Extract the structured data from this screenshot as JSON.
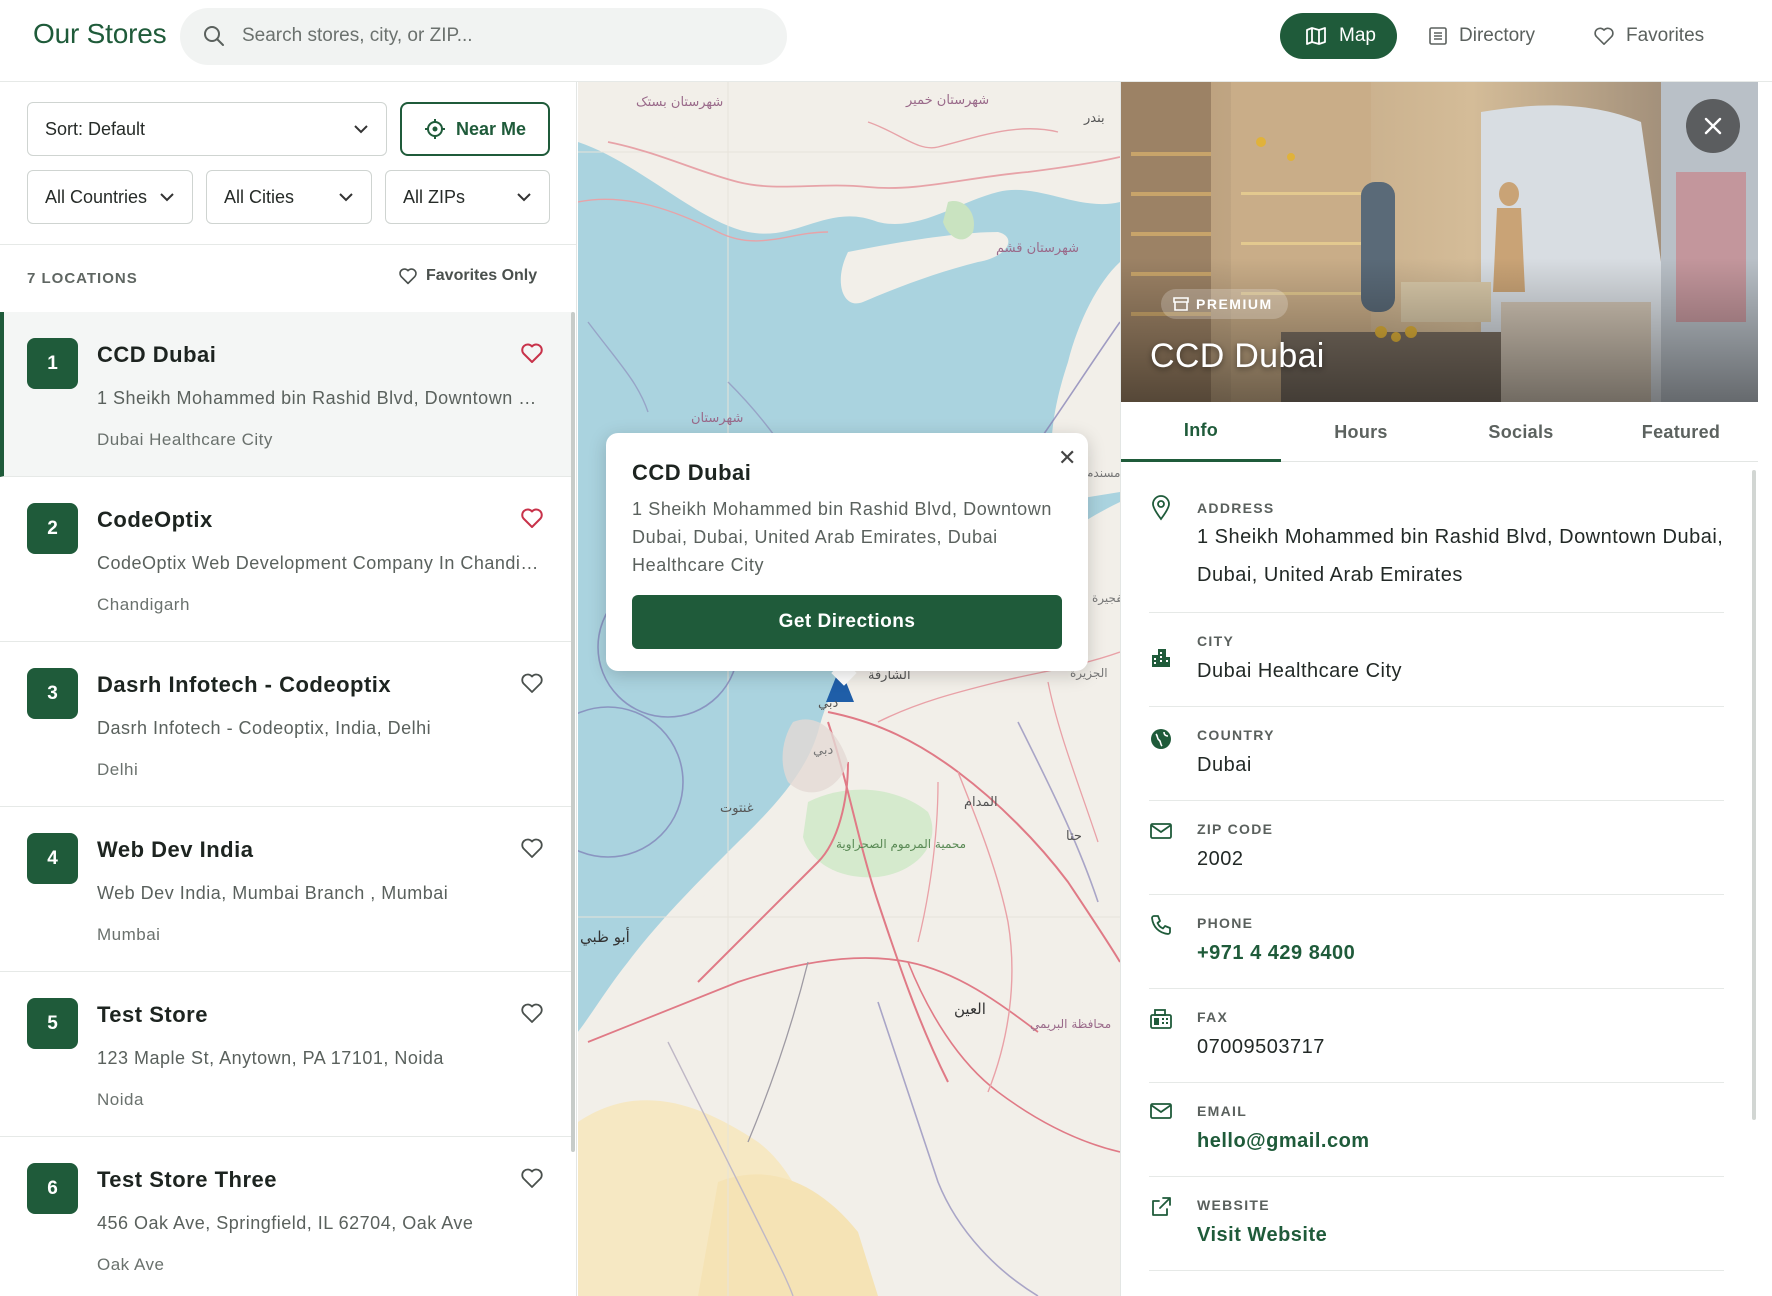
{
  "header": {
    "brand": "Our Stores",
    "search_placeholder": "Search stores, city, or ZIP...",
    "nav": {
      "map": "Map",
      "directory": "Directory",
      "favorites": "Favorites"
    }
  },
  "filters": {
    "sort": "Sort: Default",
    "near_me": "Near Me",
    "country": "All Countries",
    "city": "All Cities",
    "zip": "All ZIPs"
  },
  "list": {
    "count": "7 LOCATIONS",
    "favorites_only": "Favorites Only",
    "stores": [
      {
        "num": "1",
        "name": "CCD Dubai",
        "address": "1 Sheikh Mohammed bin Rashid Blvd, Downtown Dubai, Dubai, United Arab Emirates, Dubai Healthcare City",
        "city": "Dubai Healthcare City",
        "favorite": true
      },
      {
        "num": "2",
        "name": "CodeOptix",
        "address": "CodeOptix Web Development Company In Chandigarh",
        "city": "Chandigarh",
        "favorite": true
      },
      {
        "num": "3",
        "name": "Dasrh Infotech - Codeoptix",
        "address": "Dasrh Infotech - Codeoptix, India, Delhi",
        "city": "Delhi",
        "favorite": false
      },
      {
        "num": "4",
        "name": "Web Dev India",
        "address": "Web Dev India, Mumbai Branch , Mumbai",
        "city": "Mumbai",
        "favorite": false
      },
      {
        "num": "5",
        "name": "Test Store",
        "address": "123 Maple St, Anytown, PA 17101, Noida",
        "city": "Noida",
        "favorite": false
      },
      {
        "num": "6",
        "name": "Test Store Three",
        "address": "456 Oak Ave, Springfield, IL 62704, Oak Ave",
        "city": "Oak Ave",
        "favorite": false
      }
    ]
  },
  "map": {
    "labels": {
      "khamir": "شهرستان خمیر",
      "sang": "شهرستان بستک",
      "qeshm": "شهرستان قشم",
      "shahrestan": "شهرستان",
      "sharjah": "الشارقة",
      "dubai": "دبي",
      "dubai2": "دبي",
      "ghantoot": "غنتوت",
      "marmoom": "محمية المرموم الصحراوية",
      "madam": "المدام",
      "hatta": "حتا",
      "abudhabi": "أبو ظبي",
      "alain": "العين",
      "buraimi": "محافظة البريمي",
      "jazeera": "الجزيرة",
      "fujairah": "الفجيرة",
      "musandam": "مسندم",
      "bandar": "بندر"
    },
    "popup": {
      "title": "CCD Dubai",
      "address": "1 Sheikh Mohammed bin Rashid Blvd, Downtown Dubai, Dubai, United Arab Emirates, Dubai Healthcare City",
      "button": "Get Directions"
    }
  },
  "detail": {
    "badge": "PREMIUM",
    "title": "CCD Dubai",
    "tabs": [
      "Info",
      "Hours",
      "Socials",
      "Featured"
    ],
    "fields": {
      "address_label": "ADDRESS",
      "address": "1 Sheikh Mohammed bin Rashid Blvd, Downtown Dubai, Dubai, United Arab Emirates",
      "city_label": "CITY",
      "city": "Dubai Healthcare City",
      "country_label": "COUNTRY",
      "country": "Dubai",
      "zip_label": "ZIP CODE",
      "zip": "2002",
      "phone_label": "PHONE",
      "phone": "+971 4 429 8400",
      "fax_label": "FAX",
      "fax": "07009503717",
      "email_label": "EMAIL",
      "email": "hello@gmail.com",
      "website_label": "WEBSITE",
      "website": "Visit Website"
    }
  },
  "colors": {
    "brand": "#1f5b3a",
    "heart": "#c8324a",
    "water": "#aad3df",
    "land": "#f2efe9"
  }
}
